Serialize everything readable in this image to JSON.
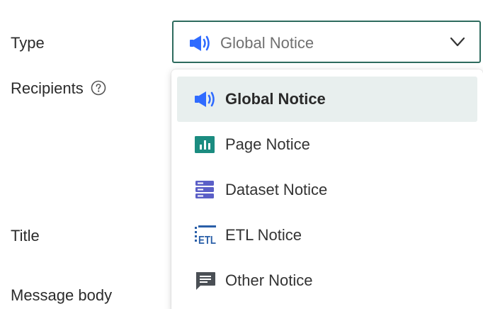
{
  "form": {
    "type_label": "Type",
    "recipients_label": "Recipients",
    "title_label": "Title",
    "message_label": "Message body"
  },
  "select": {
    "value": "Global Notice",
    "icon": "megaphone-icon"
  },
  "dropdown": {
    "options": [
      {
        "label": "Global Notice",
        "icon": "megaphone-icon",
        "selected": true
      },
      {
        "label": "Page Notice",
        "icon": "page-chart-icon",
        "selected": false
      },
      {
        "label": "Dataset Notice",
        "icon": "dataset-icon",
        "selected": false
      },
      {
        "label": "ETL Notice",
        "icon": "etl-icon",
        "selected": false
      },
      {
        "label": "Other Notice",
        "icon": "comment-icon",
        "selected": false
      }
    ]
  },
  "colors": {
    "accent_border": "#2e6b5e",
    "megaphone_blue": "#2f6bff",
    "page_teal": "#1b8c80",
    "dataset_purple": "#5b5fc7",
    "etl_blue": "#2a5fa8",
    "other_gray": "#4a4f55",
    "selected_bg": "#e8efee"
  }
}
